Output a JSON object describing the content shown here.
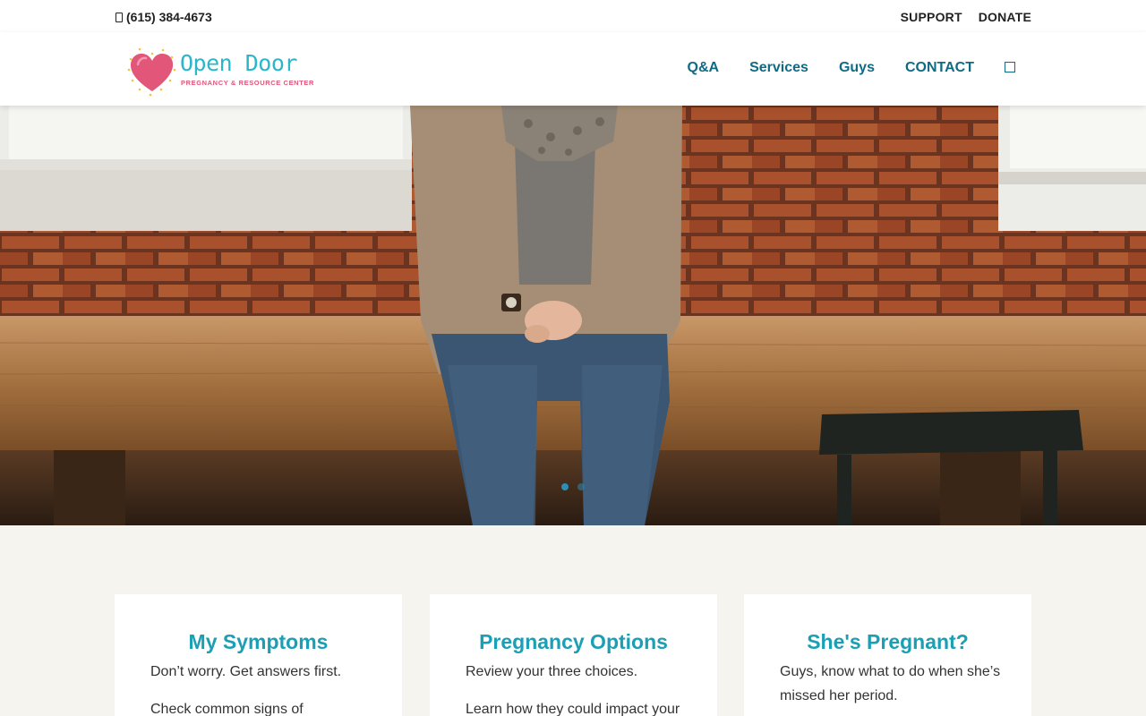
{
  "topbar": {
    "phone": "(615) 384-4673",
    "links": [
      "SUPPORT",
      "DONATE"
    ]
  },
  "logo": {
    "name": "Open Door",
    "tagline": "PREGNANCY & RESOURCE CENTER"
  },
  "nav": {
    "items": [
      "Q&A",
      "Services",
      "Guys",
      "CONTACT"
    ]
  },
  "hero": {
    "slides": 2,
    "active_slide": 1
  },
  "cards": [
    {
      "title": "My Symptoms",
      "lead": "Don’t worry. Get answers first.",
      "more": "Check common signs of"
    },
    {
      "title": "Pregnancy Options",
      "lead": "Review your three choices.",
      "more": "Learn how they could impact your"
    },
    {
      "title": "She's Pregnant?",
      "lead": "Guys, know what to do when she’s missed her period.",
      "more": ""
    }
  ],
  "colors": {
    "accent": "#1a9fb4",
    "nav_text": "#0f6b84",
    "logo_heart": "#e2567a",
    "page_bg": "#f6f4ef"
  }
}
